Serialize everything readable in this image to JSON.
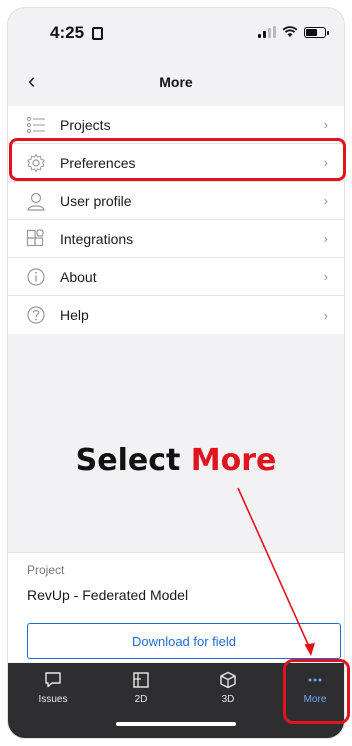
{
  "status_bar": {
    "time": "4:25"
  },
  "header": {
    "back_glyph": "‹",
    "title": "More"
  },
  "menu": {
    "items": [
      {
        "label": "Projects",
        "icon": "list-icon"
      },
      {
        "label": "Preferences",
        "icon": "gear-icon"
      },
      {
        "label": "User profile",
        "icon": "user-icon"
      },
      {
        "label": "Integrations",
        "icon": "integrations-icon"
      },
      {
        "label": "About",
        "icon": "info-icon"
      },
      {
        "label": "Help",
        "icon": "help-icon"
      }
    ],
    "chevron": "›"
  },
  "annotation": {
    "prefix": "Select ",
    "accent_text": "More",
    "accent_color": "#e0141e"
  },
  "project": {
    "caption": "Project",
    "name": "RevUp - Federated Model",
    "download_label": "Download for field"
  },
  "tabbar": {
    "tabs": [
      {
        "label": "Issues",
        "icon": "issues-icon",
        "active": false
      },
      {
        "label": "2D",
        "icon": "sheet-2d-icon",
        "active": false
      },
      {
        "label": "3D",
        "icon": "cube-3d-icon",
        "active": false
      },
      {
        "label": "More",
        "icon": "more-dots-icon",
        "active": true
      }
    ]
  },
  "colors": {
    "accent_blue": "#1f6cd4",
    "highlight_red": "#e0141e",
    "tabbar_bg": "#2e2e30",
    "active_tab": "#6ea8f5"
  }
}
